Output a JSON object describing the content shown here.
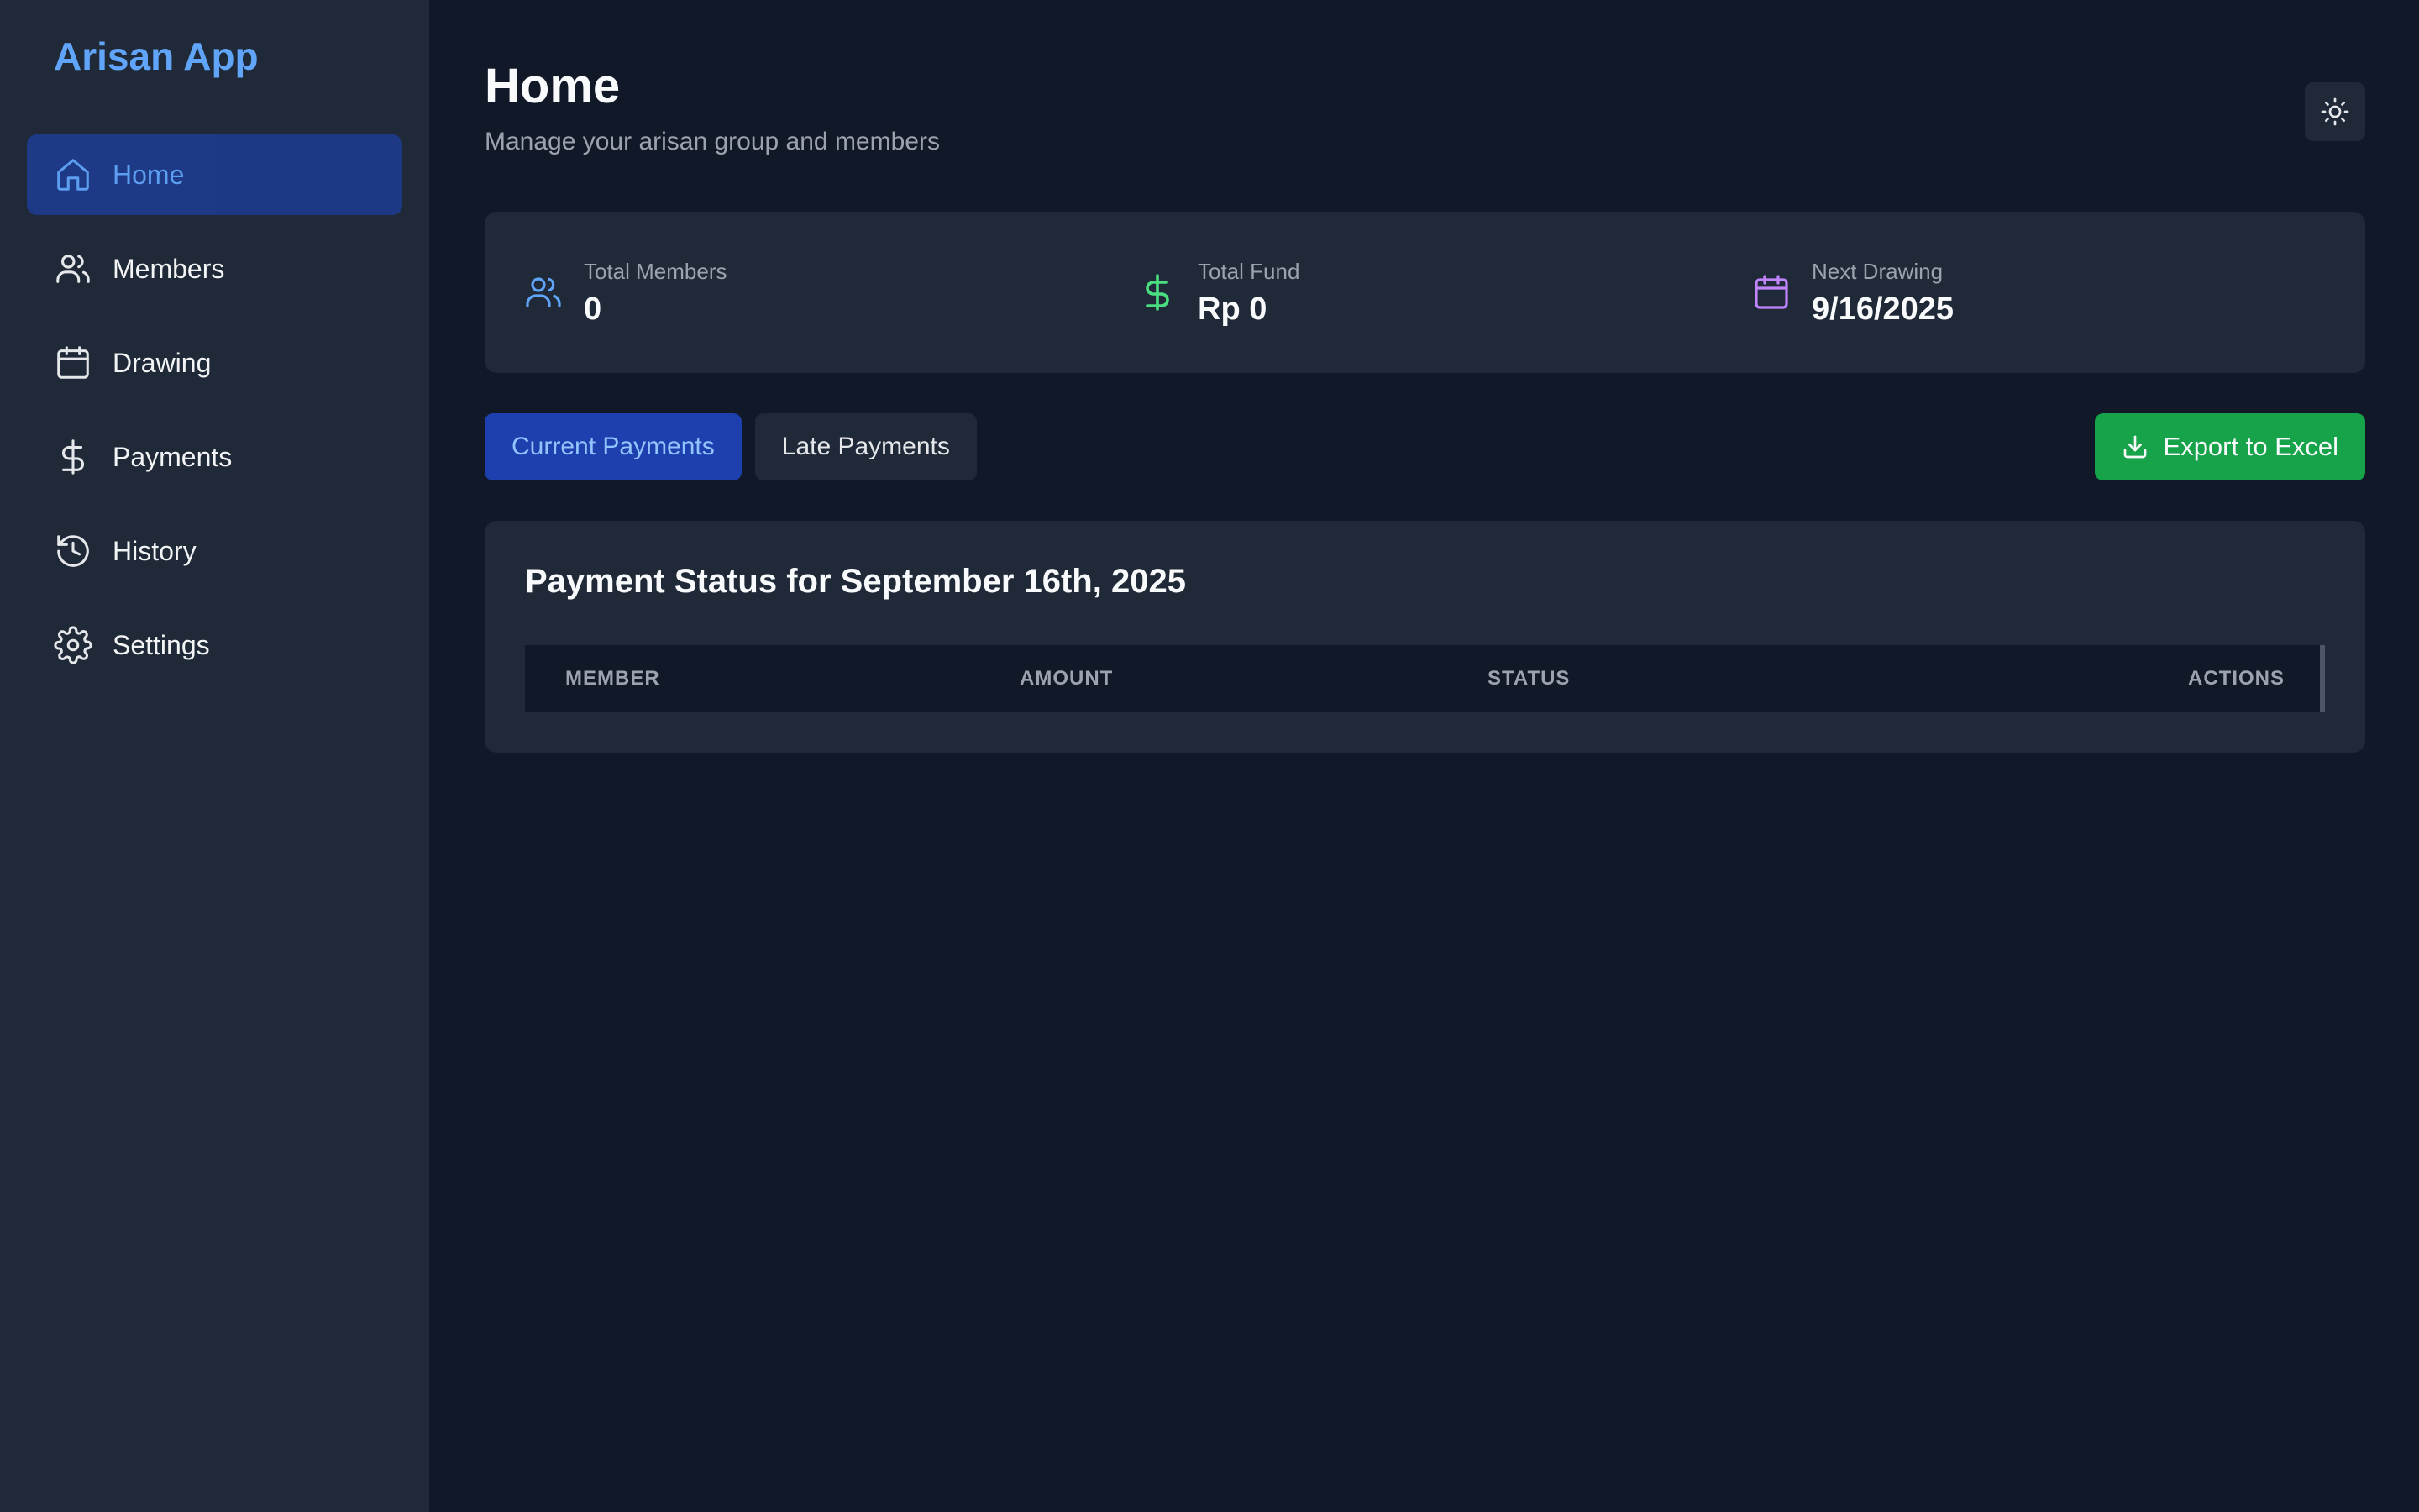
{
  "app": {
    "title": "Arisan App"
  },
  "sidebar": {
    "items": [
      {
        "label": "Home",
        "icon": "home-icon",
        "active": true
      },
      {
        "label": "Members",
        "icon": "users-icon",
        "active": false
      },
      {
        "label": "Drawing",
        "icon": "calendar-icon",
        "active": false
      },
      {
        "label": "Payments",
        "icon": "dollar-icon",
        "active": false
      },
      {
        "label": "History",
        "icon": "history-icon",
        "active": false
      },
      {
        "label": "Settings",
        "icon": "gear-icon",
        "active": false
      }
    ]
  },
  "header": {
    "title": "Home",
    "subtitle": "Manage your arisan group and members",
    "theme_toggle_icon": "sun-icon"
  },
  "stats": [
    {
      "label": "Total Members",
      "value": "0",
      "icon": "users-icon",
      "color": "#60a5fa"
    },
    {
      "label": "Total Fund",
      "value": "Rp 0",
      "icon": "dollar-icon",
      "color": "#4ade80"
    },
    {
      "label": "Next Drawing",
      "value": "9/16/2025",
      "icon": "calendar-icon",
      "color": "#c084fc"
    }
  ],
  "tabs": [
    {
      "label": "Current Payments",
      "active": true
    },
    {
      "label": "Late Payments",
      "active": false
    }
  ],
  "export": {
    "label": "Export to Excel",
    "icon": "download-icon"
  },
  "payments": {
    "title": "Payment Status for September 16th, 2025",
    "columns": [
      "MEMBER",
      "AMOUNT",
      "STATUS",
      "ACTIONS"
    ],
    "rows": []
  },
  "colors": {
    "accent": "#60a5fa",
    "active_nav_bg": "#1e3a8a",
    "export_green": "#16a34a",
    "background": "#111827",
    "surface": "#1f2937"
  }
}
